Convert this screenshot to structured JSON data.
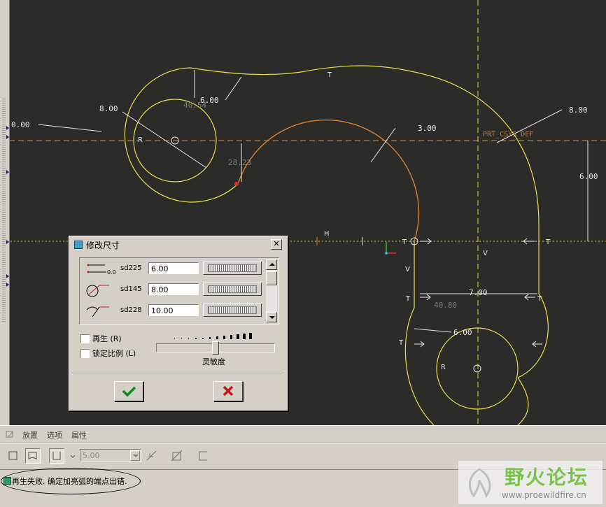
{
  "sketch": {
    "dims": {
      "top_6": "6.00",
      "left_8": "8.00",
      "arc_3": "3.00",
      "right_8": "8.00",
      "right_6": "6.00",
      "left_edge_partial": "0.00",
      "vertical_ref_1": "40.54",
      "vertical_ref_2": "28.23",
      "width_7": "7.00",
      "ref_40_80": "40.80",
      "bottom_6": "6.00"
    },
    "csys_label": "PRT_CSYS_DEF",
    "constraints": {
      "t1": "T",
      "t2": "T",
      "t3": "T",
      "t4": "T",
      "t5": "T",
      "t6": "T",
      "h": "H",
      "v1": "V",
      "v2": "V",
      "r1": "R",
      "r2": "R"
    }
  },
  "dialog": {
    "title": "修改尺寸",
    "close_label": "✕",
    "rows": [
      {
        "name": "sd225",
        "value": "6.00"
      },
      {
        "name": "sd145",
        "value": "8.00"
      },
      {
        "name": "sd228",
        "value": "10.00"
      }
    ],
    "regenerate_label": "再生 (R)",
    "lock_scale_label": "锁定比例 (L)",
    "sensitivity_label": "灵敏度",
    "sensitivity_level": 0.5
  },
  "dashboard": {
    "tabs": [
      "放置",
      "选项",
      "属性"
    ],
    "thickness_value": "5.00"
  },
  "status": {
    "message": "再生失败. 确定加亮弧的端点出错."
  },
  "watermark": {
    "name_cn": "野火论坛",
    "url": "www.proewildfire.cn"
  },
  "colors": {
    "canvas_bg": "#2b2b29",
    "sketch_yellow": "#e8e050",
    "highlight_orange": "#e08028",
    "centerline_orange": "#d89040",
    "dim_white": "#e8e8e8",
    "dialog_bg": "#d4d0c8"
  }
}
